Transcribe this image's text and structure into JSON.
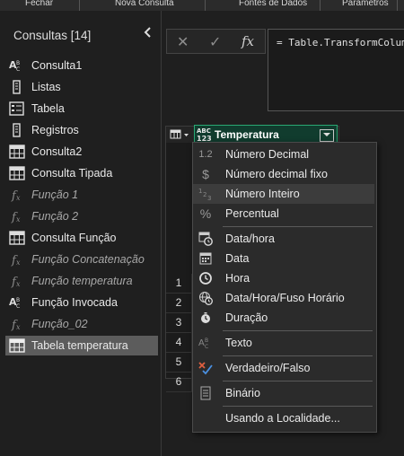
{
  "top_menu": [
    "Fechar",
    "Nova Consulta",
    "Fontes de Dados",
    "Parâmetros"
  ],
  "sidebar": {
    "title": "Consultas [14]",
    "items": [
      {
        "label": "Consulta1",
        "icon": "text-type-icon"
      },
      {
        "label": "Listas",
        "icon": "list-icon"
      },
      {
        "label": "Tabela",
        "icon": "record-icon"
      },
      {
        "label": "Registros",
        "icon": "list-icon"
      },
      {
        "label": "Consulta2",
        "icon": "table-icon"
      },
      {
        "label": "Consulta Tipada",
        "icon": "table-icon"
      },
      {
        "label": "Função 1",
        "icon": "function-icon"
      },
      {
        "label": "Função 2",
        "icon": "function-icon"
      },
      {
        "label": "Consulta Função",
        "icon": "table-icon"
      },
      {
        "label": "Função Concatenação",
        "icon": "function-icon"
      },
      {
        "label": "Função temperatura",
        "icon": "function-icon"
      },
      {
        "label": "Função Invocada",
        "icon": "text-type-icon"
      },
      {
        "label": "Função_02",
        "icon": "function-icon"
      },
      {
        "label": "Tabela temperatura",
        "icon": "table-icon",
        "selected": true
      }
    ]
  },
  "formula_bar": {
    "cancel": "✕",
    "commit": "✓",
    "fx": "fx",
    "formula": "= Table.TransformColum"
  },
  "grid": {
    "column_type_icon": "ABC\n123",
    "column_name": "Temperatura",
    "row_numbers": [
      "1",
      "2",
      "3",
      "4",
      "5",
      "6"
    ]
  },
  "type_menu": {
    "items": [
      {
        "label": "Número Decimal",
        "icon": "decimal-icon",
        "glyph": "1.2"
      },
      {
        "label": "Número decimal fixo",
        "icon": "currency-icon",
        "glyph": "$"
      },
      {
        "label": "Número Inteiro",
        "icon": "whole-number-icon",
        "glyph": "1 2 3",
        "hover": true
      },
      {
        "label": "Percentual",
        "icon": "percent-icon",
        "glyph": "%"
      },
      {
        "label": "Data/hora",
        "icon": "datetime-icon",
        "glyph": ""
      },
      {
        "label": "Data",
        "icon": "date-icon",
        "glyph": ""
      },
      {
        "label": "Hora",
        "icon": "clock-icon",
        "glyph": ""
      },
      {
        "label": "Data/Hora/Fuso Horário",
        "icon": "globe-clock-icon",
        "glyph": ""
      },
      {
        "label": "Duração",
        "icon": "duration-icon",
        "glyph": ""
      },
      {
        "label": "Texto",
        "icon": "text-type-icon",
        "glyph": "ABC"
      },
      {
        "label": "Verdadeiro/Falso",
        "icon": "boolean-icon",
        "glyph": ""
      },
      {
        "label": "Binário",
        "icon": "binary-icon",
        "glyph": ""
      },
      {
        "label": "Usando a Localidade...",
        "icon": "",
        "glyph": ""
      }
    ]
  }
}
